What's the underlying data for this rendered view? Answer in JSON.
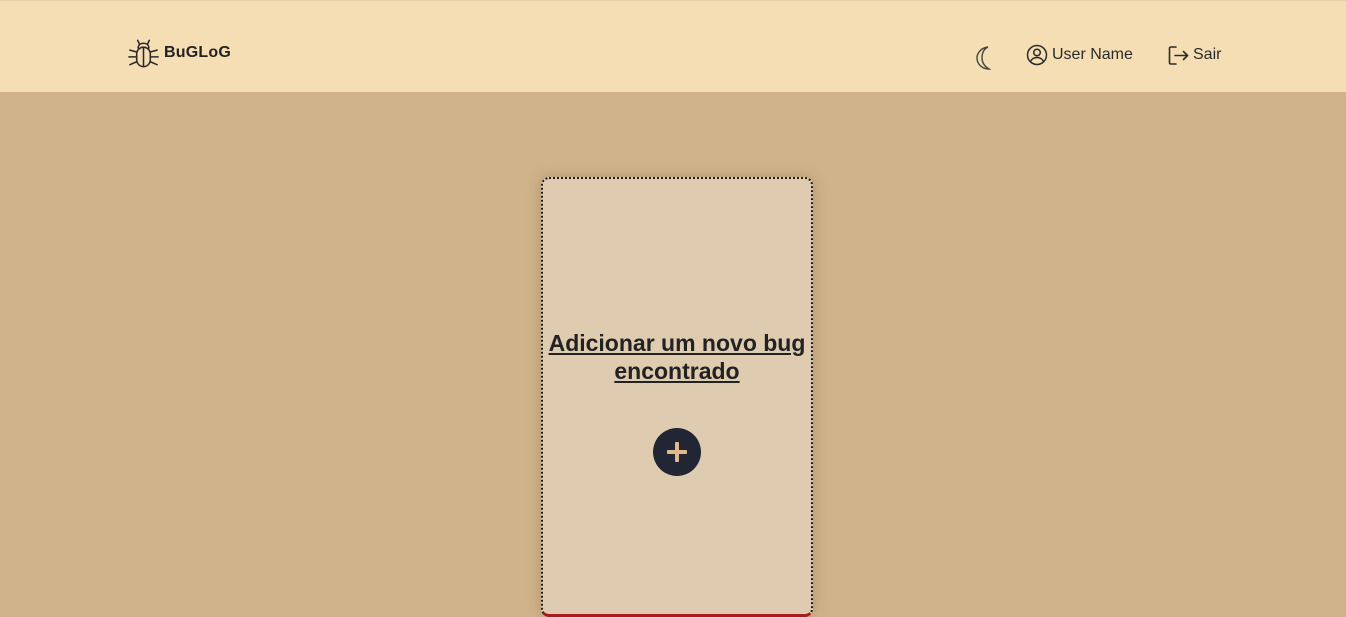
{
  "header": {
    "brand_name": "BuGLoG",
    "brand_icon": "bug-icon",
    "theme_icon": "moon-icon",
    "user_icon": "user-circle-icon",
    "user_name": "User Name",
    "logout_icon": "logout-icon",
    "logout_label": "Sair"
  },
  "card": {
    "title": "Adicionar um novo bug encontrado",
    "add_icon": "plus-icon"
  },
  "colors": {
    "header_bg": "#f5deb3",
    "page_bg": "#d0b38a",
    "card_bg": "#dfcbb0",
    "card_accent": "#a51d1d",
    "button_bg": "#222634",
    "plus_color": "#e2b98a"
  }
}
